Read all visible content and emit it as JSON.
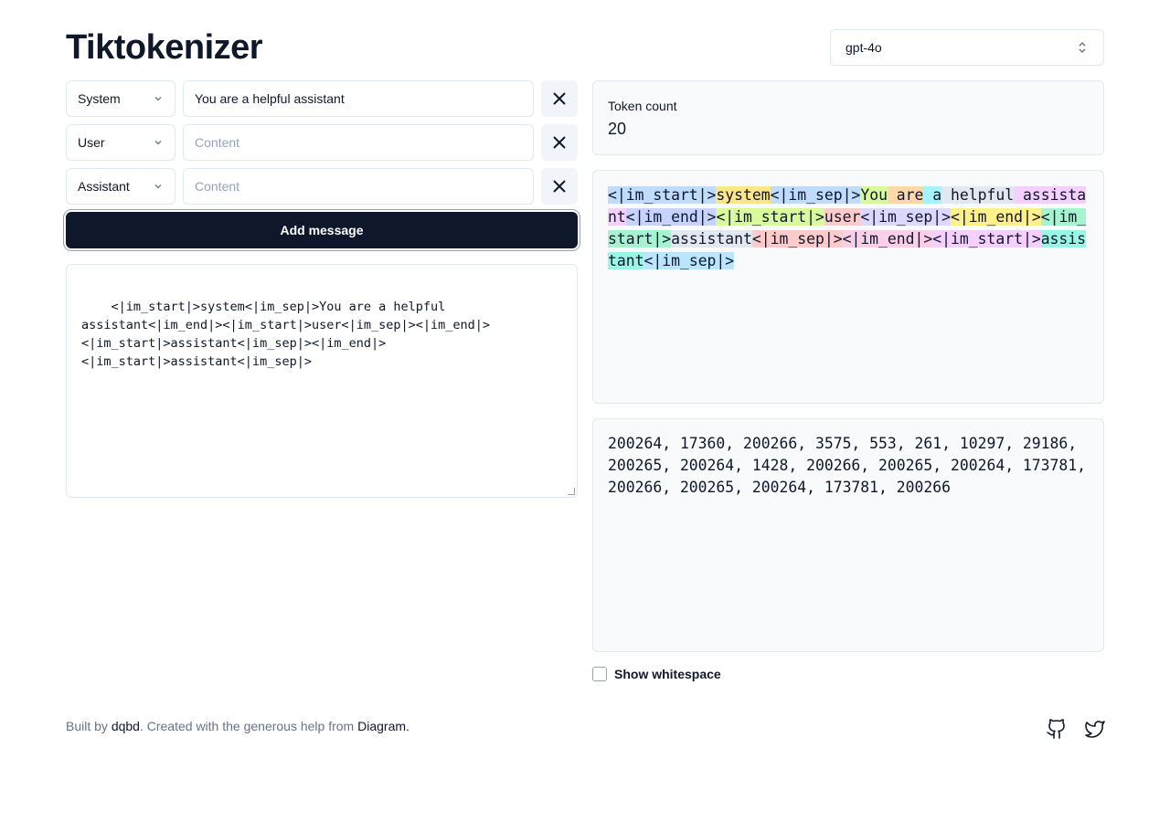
{
  "app": {
    "title": "Tiktokenizer"
  },
  "model": {
    "selected": "gpt-4o"
  },
  "messages": [
    {
      "role": "System",
      "content": "You are a helpful assistant",
      "placeholder": "Content"
    },
    {
      "role": "User",
      "content": "",
      "placeholder": "Content"
    },
    {
      "role": "Assistant",
      "content": "",
      "placeholder": "Content"
    }
  ],
  "add_label": "Add message",
  "raw_text": "<|im_start|>system<|im_sep|>You are a helpful\nassistant<|im_end|><|im_start|>user<|im_sep|><|im_end|>\n<|im_start|>assistant<|im_sep|><|im_end|>\n<|im_start|>assistant<|im_sep|>",
  "token_count": {
    "label": "Token count",
    "value": "20"
  },
  "tokens": [
    {
      "text": "<|im_start|>",
      "color": "#bfdbfe"
    },
    {
      "text": "system",
      "color": "#fde68a"
    },
    {
      "text": "<|im_sep|>",
      "color": "#bfdbfe"
    },
    {
      "text": "You",
      "color": "#d9f99d"
    },
    {
      "text": " are",
      "color": "#fed7aa"
    },
    {
      "text": " a",
      "color": "#a5f3fc"
    },
    {
      "text": " helpful",
      "color": "#e2e8f0"
    },
    {
      "text": " assistant",
      "color": "#f5d0fe"
    },
    {
      "text": "<|im_end|>",
      "color": "#c7d2fe"
    },
    {
      "text": "<|im_start|>",
      "color": "#d9f99d"
    },
    {
      "text": "user",
      "color": "#fecaca"
    },
    {
      "text": "<|im_sep|>",
      "color": "#ddd6fe"
    },
    {
      "text": "<|im_end|>",
      "color": "#fef08a"
    },
    {
      "text": "<|im_start|>",
      "color": "#a7f3d0"
    },
    {
      "text": "assistant",
      "color": "#e2e8f0"
    },
    {
      "text": "<|im_sep|>",
      "color": "#fecaca"
    },
    {
      "text": "<|im_end|>",
      "color": "#fbcfe8"
    },
    {
      "text": "<|im_start|>",
      "color": "#f5d0fe"
    },
    {
      "text": "assistant",
      "color": "#99f6e4"
    },
    {
      "text": "<|im_sep|>",
      "color": "#bae6fd"
    }
  ],
  "token_ids": "200264, 17360, 200266, 3575, 553, 261, 10297, 29186, 200265, 200264, 1428, 200266, 200265, 200264, 173781, 200266, 200265, 200264, 173781, 200266",
  "show_whitespace_label": "Show whitespace",
  "footer": {
    "prefix": "Built by ",
    "author": "dqbd",
    "middle": ". Created with the generous help from ",
    "helper": "Diagram",
    "suffix": "."
  },
  "social": [
    "github-icon",
    "twitter-icon"
  ]
}
